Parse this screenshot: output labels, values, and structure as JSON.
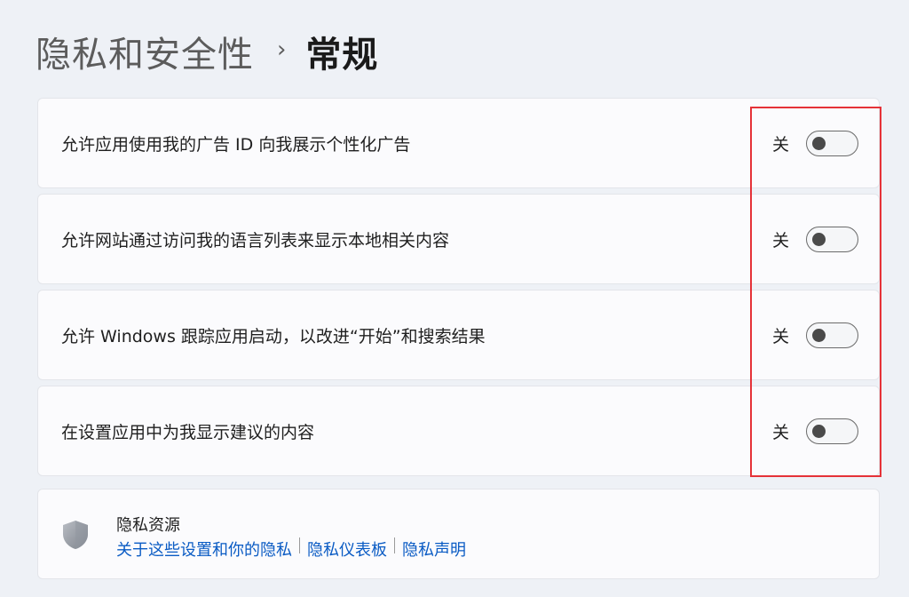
{
  "breadcrumb": {
    "parent": "隐私和安全性",
    "separator": "›",
    "current": "常规"
  },
  "settings": [
    {
      "label": "允许应用使用我的广告 ID 向我展示个性化广告",
      "state": "关"
    },
    {
      "label": "允许网站通过访问我的语言列表来显示本地相关内容",
      "state": "关"
    },
    {
      "label": "允许 Windows 跟踪应用启动，以改进“开始”和搜索结果",
      "state": "关"
    },
    {
      "label": "在设置应用中为我显示建议的内容",
      "state": "关"
    }
  ],
  "resources": {
    "title": "隐私资源",
    "links": [
      "关于这些设置和你的隐私",
      "隐私仪表板",
      "隐私声明"
    ]
  },
  "colors": {
    "link": "#0a5bc4",
    "highlight": "#e53238",
    "card": "#fbfbfd",
    "background": "#eef1f6"
  },
  "icons": {
    "shield": "shield-icon"
  }
}
